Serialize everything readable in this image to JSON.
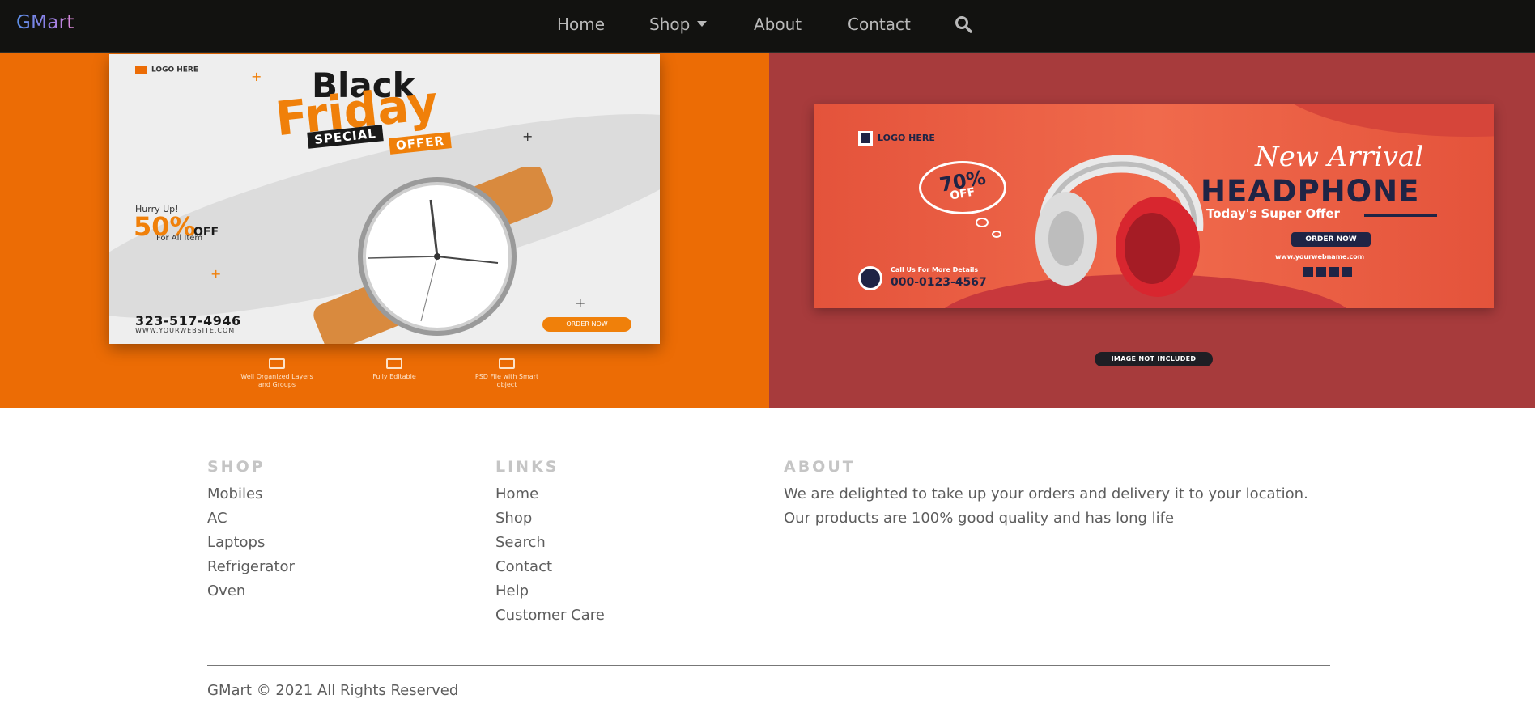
{
  "navbar": {
    "brand": "GMart",
    "items": [
      {
        "label": "Home"
      },
      {
        "label": "Shop"
      },
      {
        "label": "About"
      },
      {
        "label": "Contact"
      }
    ],
    "search_icon": "search-icon"
  },
  "banners": {
    "left": {
      "background": "#ec6c05",
      "logo": "LOGO HERE",
      "headline_1": "Black",
      "headline_2": "Friday",
      "tag_1": "SPECIAL",
      "tag_2": "OFFER",
      "hurry": "Hurry Up!",
      "percent": "50%",
      "off": "OFF",
      "for_all": "For All Item",
      "phone": "323-517-4946",
      "website": "WWW.YOURWEBSITE.COM",
      "order_button": "ORDER NOW",
      "features": [
        {
          "text": "Well Organized Layers and Groups"
        },
        {
          "text": "Fully Editable"
        },
        {
          "text": "PSD File with Smart object"
        }
      ]
    },
    "right": {
      "background": "#a73b3c",
      "logo": "LOGO HERE",
      "discount": "70%",
      "discount_off": "OFF",
      "call_label": "Call Us For More Details",
      "call_number": "000-0123-4567",
      "new_arrival": "New Arrival",
      "title": "HEADPHONE",
      "super_offer": "Today's Super Offer",
      "order_button": "ORDER NOW",
      "website": "www.yourwebname.com",
      "image_note": "IMAGE NOT INCLUDED"
    }
  },
  "footer": {
    "shop": {
      "heading": "SHOP",
      "items": [
        "Mobiles",
        "AC",
        "Laptops",
        "Refrigerator",
        "Oven"
      ]
    },
    "links": {
      "heading": "LINKS",
      "items": [
        "Home",
        "Shop",
        "Search",
        "Contact",
        "Help",
        "Customer Care"
      ]
    },
    "about": {
      "heading": "ABOUT",
      "text_line_1": "We are delighted to take up your orders and delivery it to your location.",
      "text_line_2": "Our products are 100% good quality and has long life"
    },
    "copyright": "GMart © 2021 All Rights Reserved"
  }
}
